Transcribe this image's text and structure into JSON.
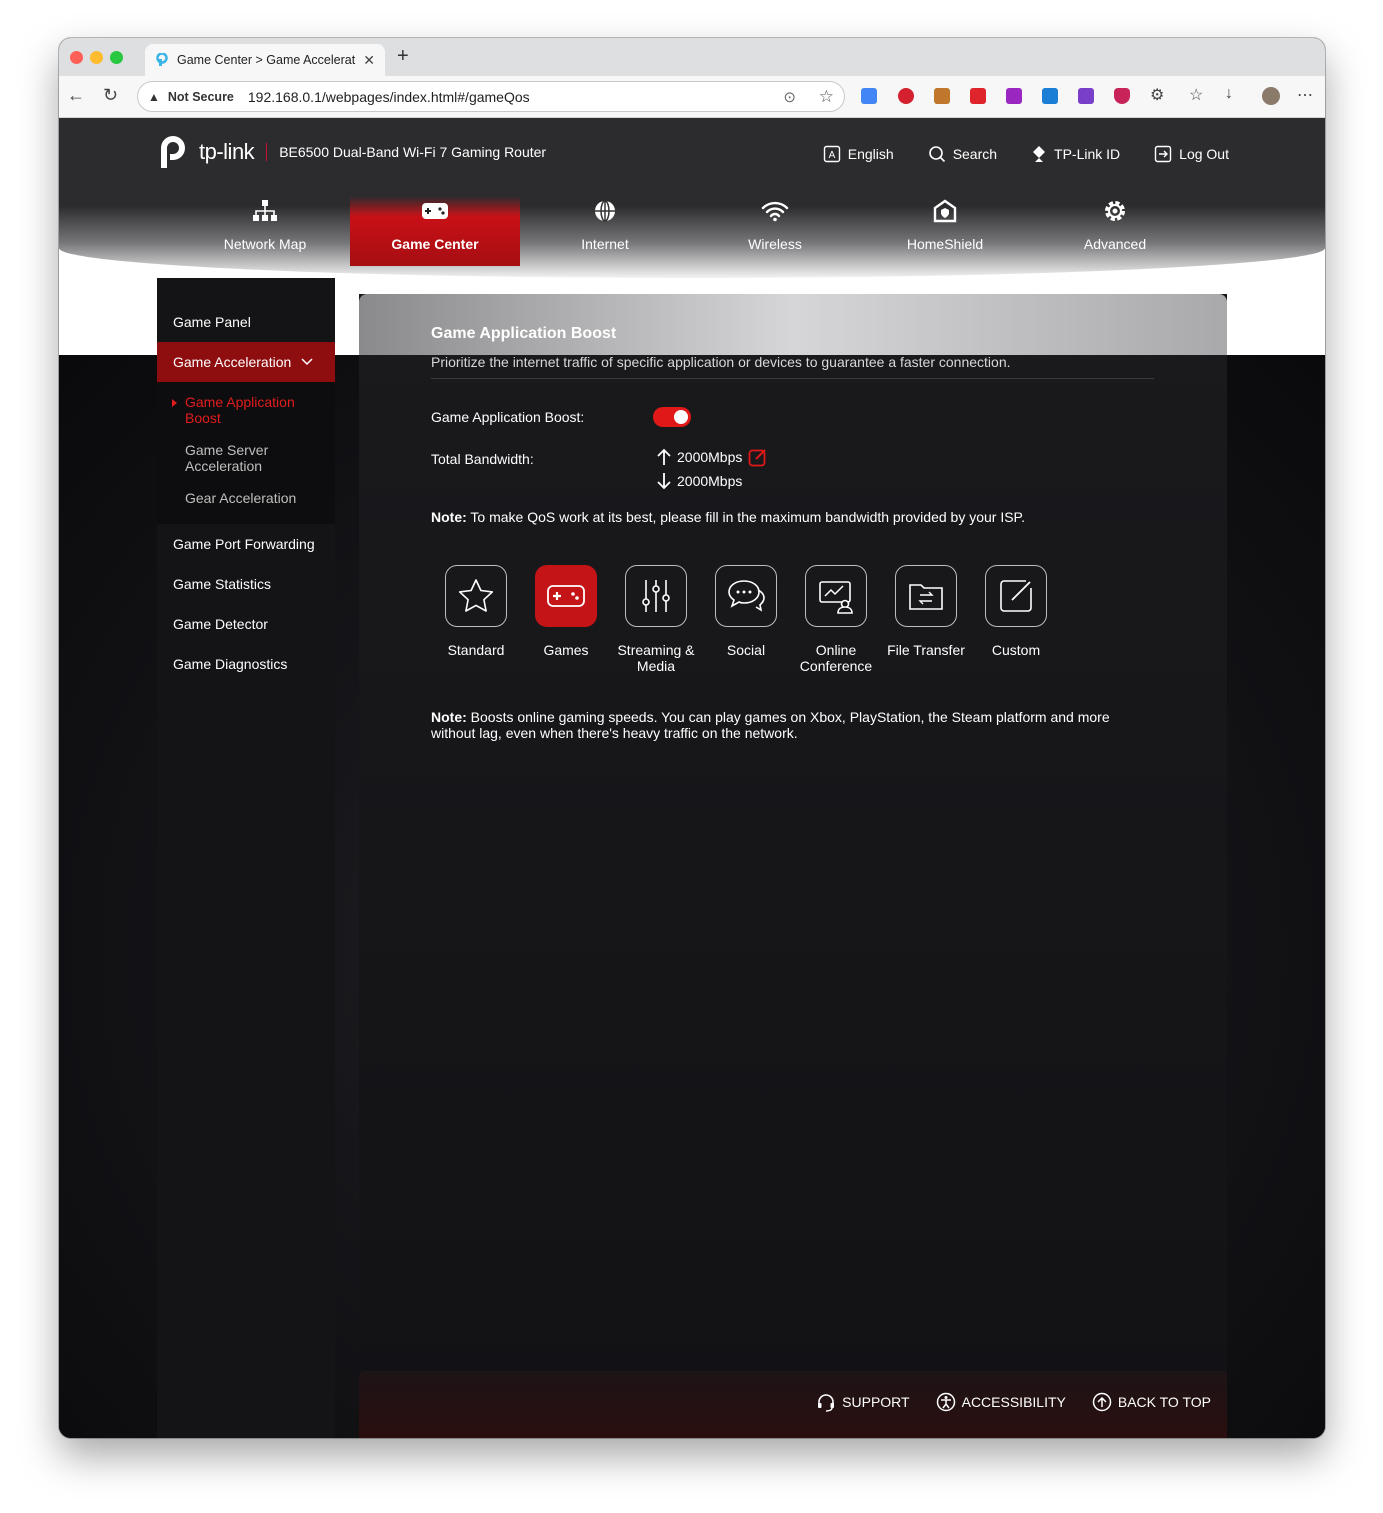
{
  "browser": {
    "tab_title": "Game Center > Game Accelerat",
    "security_label": "Not Secure",
    "url": "192.168.0.1/webpages/index.html#/gameQos"
  },
  "header": {
    "brand": "tp-link",
    "model": "BE6500 Dual-Band Wi-Fi 7 Gaming Router",
    "links": [
      "English",
      "Search",
      "TP-Link ID",
      "Log Out"
    ]
  },
  "main_nav": [
    "Network Map",
    "Game Center",
    "Internet",
    "Wireless",
    "HomeShield",
    "Advanced"
  ],
  "main_nav_active": "Game Center",
  "sidebar": {
    "items_top": [
      "Game Panel"
    ],
    "active": "Game Acceleration",
    "sub": [
      {
        "label": "Game Application Boost",
        "current": true
      },
      {
        "label": "Game Server Acceleration",
        "current": false
      },
      {
        "label": "Gear Acceleration",
        "current": false
      }
    ],
    "items_bottom": [
      "Game Port Forwarding",
      "Game Statistics",
      "Game Detector",
      "Game Diagnostics"
    ]
  },
  "content": {
    "title": "Game Application Boost",
    "description": "Prioritize the internet traffic of specific application or devices to guarantee a faster connection.",
    "boost_label": "Game Application Boost:",
    "boost_enabled": true,
    "bandwidth_label": "Total Bandwidth:",
    "upload": "2000Mbps",
    "download": "2000Mbps",
    "note1_bold": "Note:",
    "note1_text": " To make QoS work at its best, please fill in the maximum bandwidth provided by your ISP.",
    "modes": [
      "Standard",
      "Games",
      "Streaming & Media",
      "Social",
      "Online Conference",
      "File Transfer",
      "Custom"
    ],
    "selected_mode": "Games",
    "note2_bold": "Note:",
    "note2_text": " Boosts online gaming speeds. You can play games on Xbox, PlayStation, the Steam platform and more without lag, even when there's heavy traffic on the network."
  },
  "footer": [
    "SUPPORT",
    "ACCESSIBILITY",
    "BACK TO TOP"
  ],
  "colors": {
    "accent": "#e01818",
    "dark": "#141416"
  }
}
